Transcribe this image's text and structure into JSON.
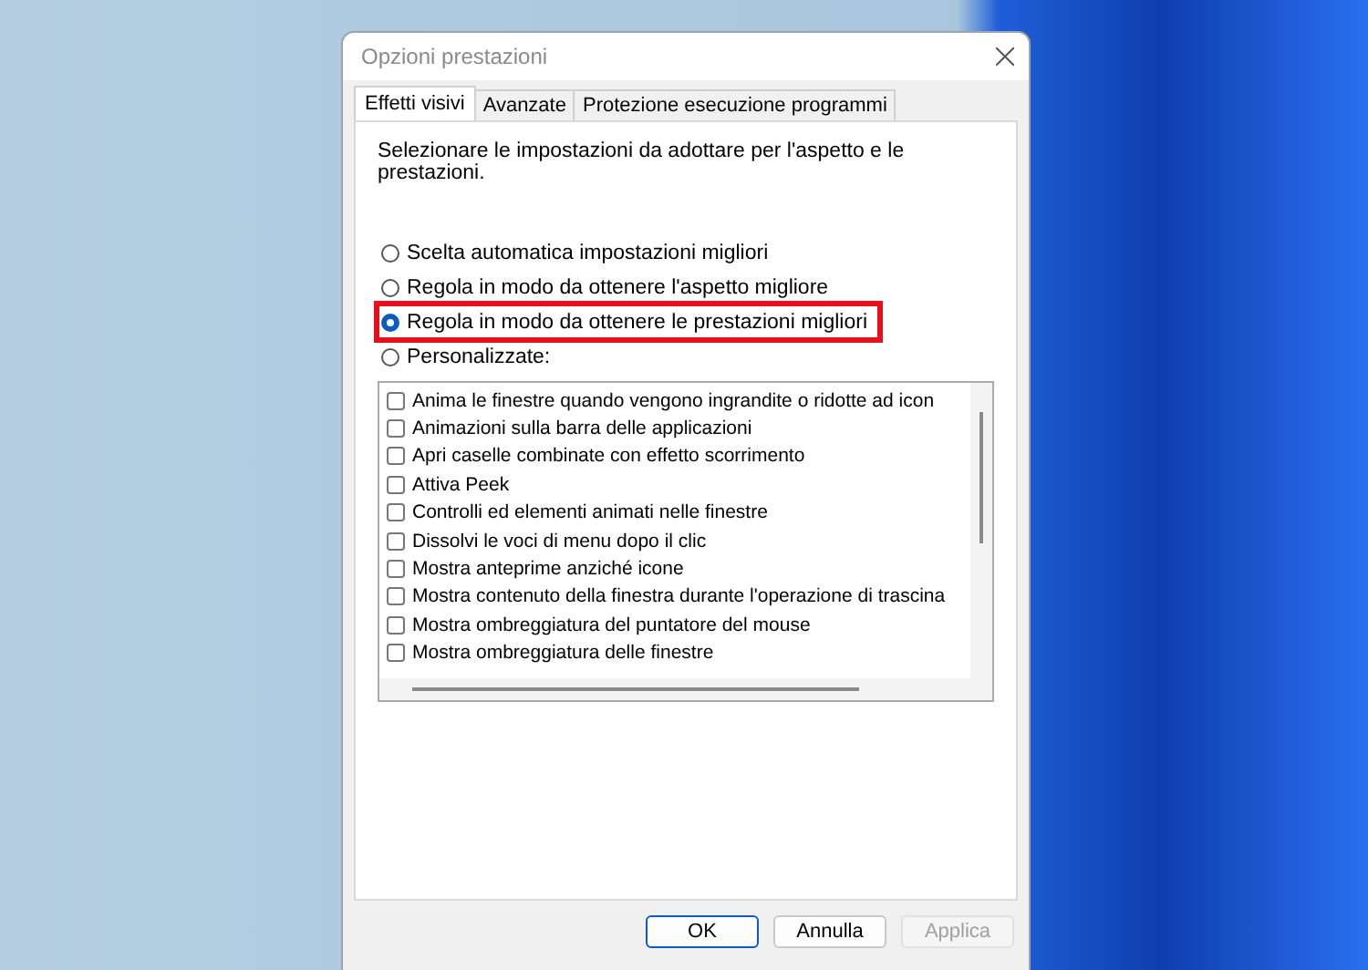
{
  "window": {
    "title": "Opzioni prestazioni"
  },
  "tabs": [
    {
      "label": "Effetti visivi",
      "selected": true
    },
    {
      "label": "Avanzate",
      "selected": false
    },
    {
      "label": "Protezione esecuzione programmi",
      "selected": false
    }
  ],
  "description": "Selezionare le impostazioni da adottare per l'aspetto e le prestazioni.",
  "options": [
    {
      "label": "Scelta automatica impostazioni migliori",
      "selected": false,
      "highlighted": false
    },
    {
      "label": "Regola in modo da ottenere l'aspetto migliore",
      "selected": false,
      "highlighted": false
    },
    {
      "label": "Regola in modo da ottenere le prestazioni migliori",
      "selected": true,
      "highlighted": true
    },
    {
      "label": "Personalizzate:",
      "selected": false,
      "highlighted": false
    }
  ],
  "effects": [
    {
      "label": "Anima le finestre quando vengono ingrandite o ridotte ad icon",
      "checked": false
    },
    {
      "label": "Animazioni sulla barra delle applicazioni",
      "checked": false
    },
    {
      "label": "Apri caselle combinate con effetto scorrimento",
      "checked": false
    },
    {
      "label": "Attiva Peek",
      "checked": false
    },
    {
      "label": "Controlli ed elementi animati nelle finestre",
      "checked": false
    },
    {
      "label": "Dissolvi le voci di menu dopo il clic",
      "checked": false
    },
    {
      "label": "Mostra anteprime anziché icone",
      "checked": false
    },
    {
      "label": "Mostra contenuto della finestra durante l'operazione di trascina",
      "checked": false
    },
    {
      "label": "Mostra ombreggiatura del puntatore del mouse",
      "checked": false
    },
    {
      "label": "Mostra ombreggiatura delle finestre",
      "checked": false
    }
  ],
  "buttons": [
    {
      "label": "OK",
      "kind": "default",
      "disabled": false
    },
    {
      "label": "Annulla",
      "kind": "normal",
      "disabled": false
    },
    {
      "label": "Applica",
      "kind": "normal",
      "disabled": true
    }
  ]
}
